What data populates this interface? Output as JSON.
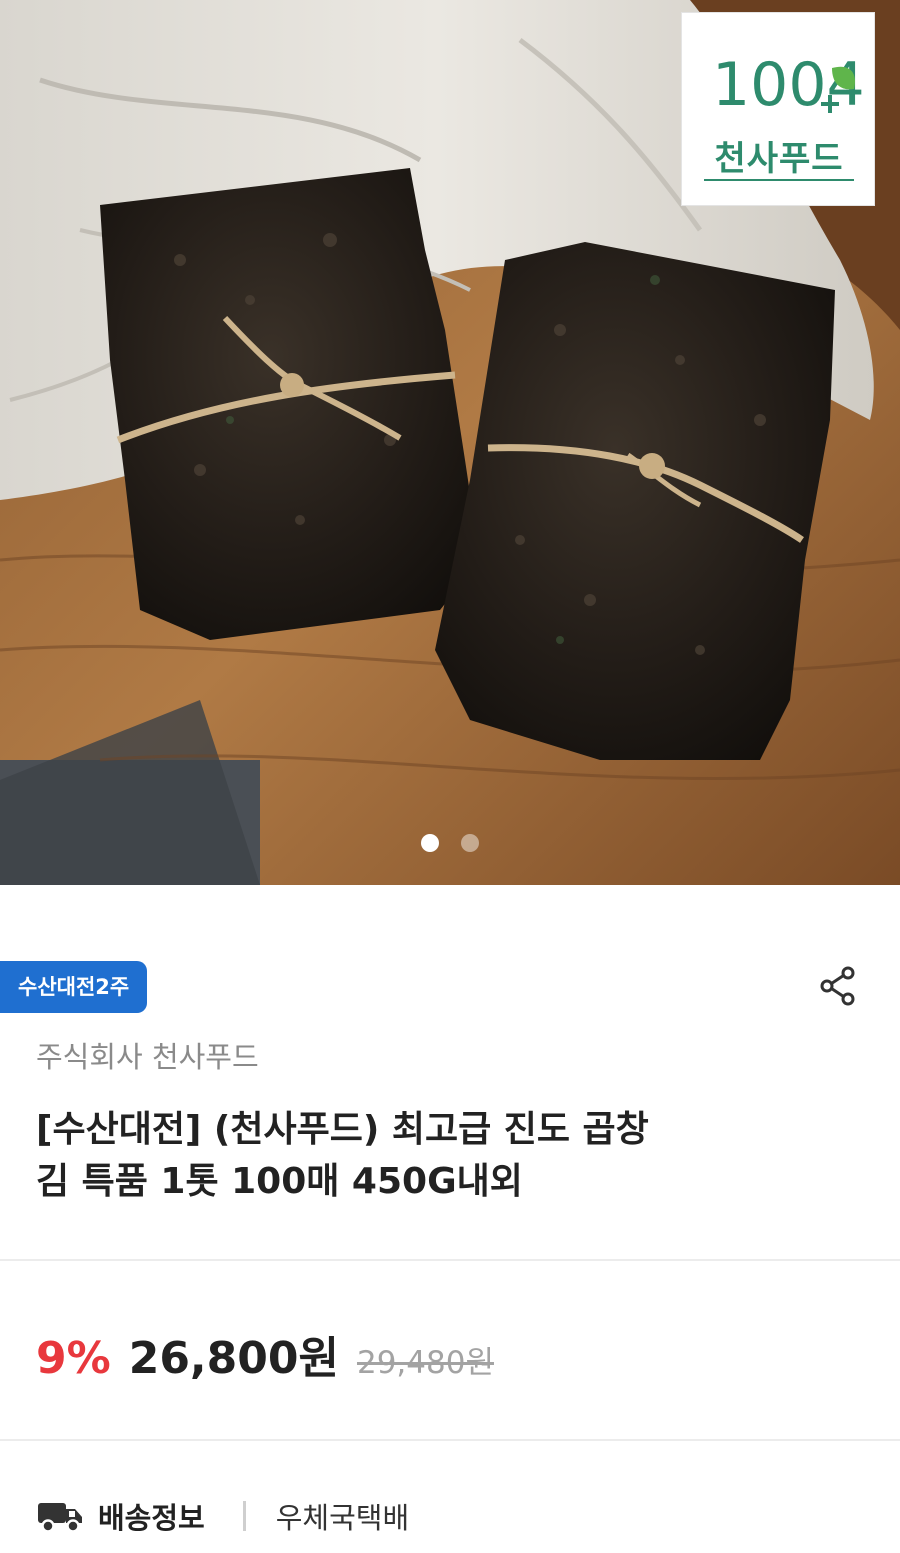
{
  "gallery": {
    "page_count": 2,
    "active_index": 0,
    "brand_logo_text": "1004",
    "brand_logo_name": "천사푸드",
    "colors": {
      "logo_green": "#2e8b6d"
    }
  },
  "product": {
    "badge": "수산대전2주",
    "seller": "주식회사 천사푸드",
    "title_line1": "[수산대전] (천사푸드) 최고급 진도 곱창",
    "title_line2": "김 특품 1톳 100매 450G내외"
  },
  "pricing": {
    "discount": "9%",
    "price": "26,800원",
    "original_price": "29,480원",
    "colors": {
      "discount": "#e8383d",
      "badge": "#1f6fd0"
    }
  },
  "shipping": {
    "label": "배송정보",
    "value": "우체국택배",
    "icon": "truck-icon"
  },
  "actions": {
    "share_icon": "share-icon"
  }
}
